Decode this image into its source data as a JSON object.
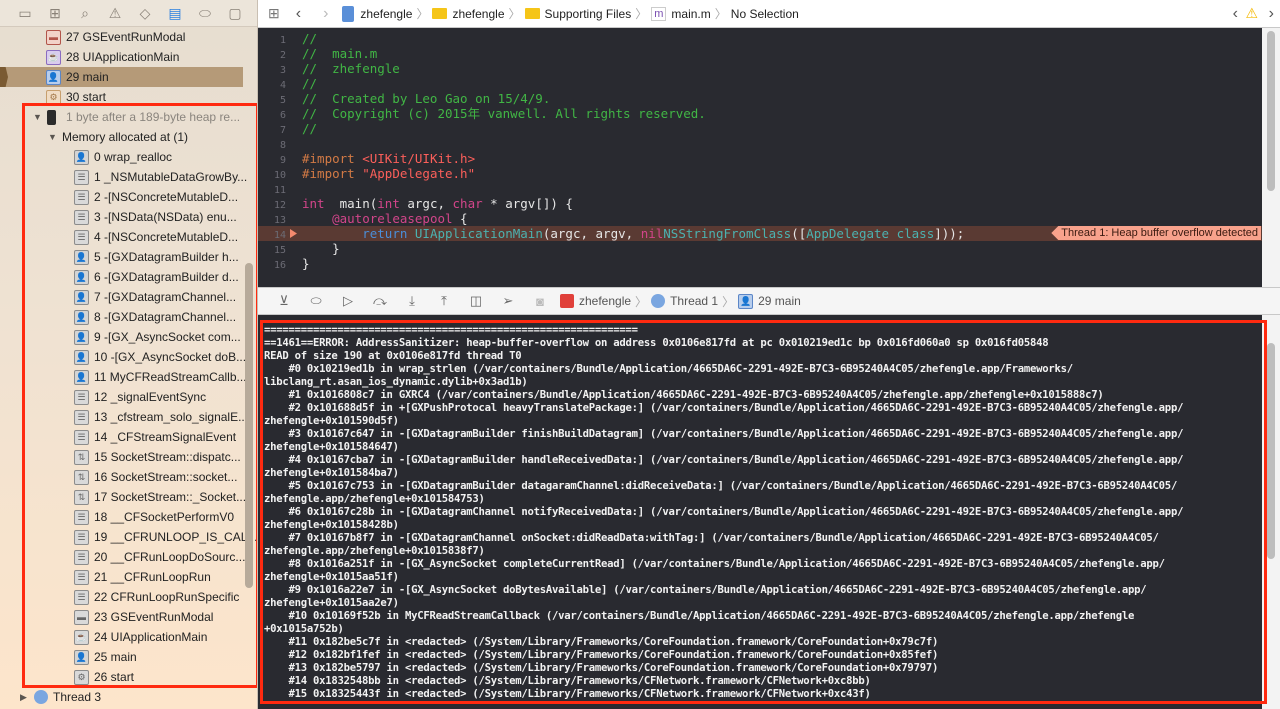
{
  "navigator": {
    "tabs": [
      "folder-icon",
      "hierarchy-icon",
      "search-icon",
      "warning-icon",
      "breakpoint-diamond-icon",
      "debug-navigator-icon",
      "breakpoint-tag-icon",
      "report-icon"
    ],
    "active_tab": "debug-navigator-icon",
    "frames": [
      {
        "label": "27 GSEventRunModal",
        "icon": "briefcase",
        "level": 0
      },
      {
        "label": "28 UIApplicationMain",
        "icon": "cup",
        "level": 0
      },
      {
        "label": "29 main",
        "icon": "user",
        "level": 0,
        "selected": true
      },
      {
        "label": "30 start",
        "icon": "gear",
        "level": 0
      }
    ],
    "asan_issue": {
      "title": "1 byte after a 189-byte heap re...",
      "group": "Memory allocated at (1)",
      "frames": [
        {
          "label": "0 wrap_realloc",
          "icon": "gray-user"
        },
        {
          "label": "1 _NSMutableDataGrowBy...",
          "icon": "lib"
        },
        {
          "label": "2 -[NSConcreteMutableD...",
          "icon": "lib"
        },
        {
          "label": "3 -[NSData(NSData) enu...",
          "icon": "lib"
        },
        {
          "label": "4 -[NSConcreteMutableD...",
          "icon": "lib"
        },
        {
          "label": "5 -[GXDatagramBuilder h...",
          "icon": "gray-user"
        },
        {
          "label": "6 -[GXDatagramBuilder d...",
          "icon": "gray-user"
        },
        {
          "label": "7 -[GXDatagramChannel...",
          "icon": "gray-user"
        },
        {
          "label": "8 -[GXDatagramChannel...",
          "icon": "gray-user"
        },
        {
          "label": "9 -[GX_AsyncSocket com...",
          "icon": "gray-user"
        },
        {
          "label": "10 -[GX_AsyncSocket doB...",
          "icon": "gray-user"
        },
        {
          "label": "11 MyCFReadStreamCallb...",
          "icon": "gray-user"
        },
        {
          "label": "12 _signalEventSync",
          "icon": "lib"
        },
        {
          "label": "13 _cfstream_solo_signalE...",
          "icon": "lib"
        },
        {
          "label": "14 _CFStreamSignalEvent",
          "icon": "lib"
        },
        {
          "label": "15 SocketStream::dispatc...",
          "icon": "socket"
        },
        {
          "label": "16 SocketStream::socket...",
          "icon": "socket"
        },
        {
          "label": "17 SocketStream::_Socket...",
          "icon": "socket"
        },
        {
          "label": "18 __CFSocketPerformV0",
          "icon": "lib"
        },
        {
          "label": "19 __CFRUNLOOP_IS_CAL...",
          "icon": "lib"
        },
        {
          "label": "20 __CFRunLoopDoSourc...",
          "icon": "lib"
        },
        {
          "label": "21 __CFRunLoopRun",
          "icon": "lib"
        },
        {
          "label": "22 CFRunLoopRunSpecific",
          "icon": "lib"
        },
        {
          "label": "23 GSEventRunModal",
          "icon": "briefcase-gray"
        },
        {
          "label": "24 UIApplicationMain",
          "icon": "cup-gray"
        },
        {
          "label": "25 main",
          "icon": "gray-user"
        },
        {
          "label": "26 start",
          "icon": "gear-gray"
        }
      ]
    },
    "thread3": "Thread 3"
  },
  "jumpbar": {
    "crumbs": [
      "zhefengle",
      "zhefengle",
      "Supporting Files",
      "main.m",
      "No Selection"
    ]
  },
  "editor": {
    "lines": [
      [
        [
          "cm",
          "//"
        ]
      ],
      [
        [
          "cm",
          "//  main.m"
        ]
      ],
      [
        [
          "cm",
          "//  zhefengle"
        ]
      ],
      [
        [
          "cm",
          "//"
        ]
      ],
      [
        [
          "cm",
          "//  Created by Leo Gao on 15/4/9."
        ]
      ],
      [
        [
          "cm",
          "//  Copyright (c) 2015年 vanwell. All rights reserved."
        ]
      ],
      [
        [
          "cm",
          "//"
        ]
      ],
      [],
      [
        [
          "pp",
          "#import "
        ],
        [
          "st",
          "<UIKit/UIKit.h>"
        ]
      ],
      [
        [
          "pp",
          "#import "
        ],
        [
          "st",
          "\"AppDelegate.h\""
        ]
      ],
      [],
      [
        [
          "kw",
          "int"
        ],
        [
          "",
          "  main("
        ],
        [
          "kw",
          "int"
        ],
        [
          "",
          " argc, "
        ],
        [
          "kw",
          "char"
        ],
        [
          "",
          " * argv[]) {"
        ]
      ],
      [
        [
          "",
          "    "
        ],
        [
          "kw",
          "@autoreleasepool"
        ],
        [
          "",
          " {"
        ]
      ],
      [
        [
          "",
          "        "
        ],
        [
          "kb",
          "return"
        ],
        [
          "",
          " "
        ],
        [
          "fn",
          "UIApplicationMain"
        ],
        [
          "",
          "(argc, argv, "
        ],
        [
          "kw",
          "nil"
        ],
        [
          ", ",
          ""
        ],
        [
          "fn",
          "NSStringFromClass"
        ],
        [
          "",
          "(["
        ],
        [
          "fn",
          "AppDelegate"
        ],
        [
          "",
          " "
        ],
        [
          "fn",
          "class"
        ],
        [
          "",
          "]));"
        ]
      ],
      [
        [
          "",
          "    }"
        ]
      ],
      [
        [
          "",
          "}"
        ]
      ]
    ],
    "highlighted_line": 14,
    "issue_badge": "Thread 1: Heap buffer overflow detected"
  },
  "debugbar": {
    "process": "zhefengle",
    "thread": "Thread 1",
    "frame": "29 main"
  },
  "console": {
    "lines": [
      "=============================================================",
      "==1461==ERROR: AddressSanitizer: heap-buffer-overflow on address 0x0106e817fd at pc 0x010219ed1c bp 0x016fd060a0 sp 0x016fd05848",
      "READ of size 190 at 0x0106e817fd thread T0",
      "    #0 0x10219ed1b in wrap_strlen (/var/containers/Bundle/Application/4665DA6C-2291-492E-B7C3-6B95240A4C05/zhefengle.app/Frameworks/",
      "libclang_rt.asan_ios_dynamic.dylib+0x3ad1b)",
      "    #1 0x1016808c7 in GXRC4 (/var/containers/Bundle/Application/4665DA6C-2291-492E-B7C3-6B95240A4C05/zhefengle.app/zhefengle+0x1015888c7)",
      "    #2 0x101688d5f in +[GXPushProtocal heavyTranslatePackage:] (/var/containers/Bundle/Application/4665DA6C-2291-492E-B7C3-6B95240A4C05/zhefengle.app/",
      "zhefengle+0x101590d5f)",
      "    #3 0x10167c647 in -[GXDatagramBuilder finishBuildDatagram] (/var/containers/Bundle/Application/4665DA6C-2291-492E-B7C3-6B95240A4C05/zhefengle.app/",
      "zhefengle+0x101584647)",
      "    #4 0x10167cba7 in -[GXDatagramBuilder handleReceivedData:] (/var/containers/Bundle/Application/4665DA6C-2291-492E-B7C3-6B95240A4C05/zhefengle.app/",
      "zhefengle+0x101584ba7)",
      "    #5 0x10167c753 in -[GXDatagramBuilder datagaramChannel:didReceiveData:] (/var/containers/Bundle/Application/4665DA6C-2291-492E-B7C3-6B95240A4C05/",
      "zhefengle.app/zhefengle+0x101584753)",
      "    #6 0x10167c28b in -[GXDatagramChannel notifyReceivedData:] (/var/containers/Bundle/Application/4665DA6C-2291-492E-B7C3-6B95240A4C05/zhefengle.app/",
      "zhefengle+0x10158428b)",
      "    #7 0x10167b8f7 in -[GXDatagramChannel onSocket:didReadData:withTag:] (/var/containers/Bundle/Application/4665DA6C-2291-492E-B7C3-6B95240A4C05/",
      "zhefengle.app/zhefengle+0x1015838f7)",
      "    #8 0x1016a251f in -[GX_AsyncSocket completeCurrentRead] (/var/containers/Bundle/Application/4665DA6C-2291-492E-B7C3-6B95240A4C05/zhefengle.app/",
      "zhefengle+0x1015aa51f)",
      "    #9 0x1016a22e7 in -[GX_AsyncSocket doBytesAvailable] (/var/containers/Bundle/Application/4665DA6C-2291-492E-B7C3-6B95240A4C05/zhefengle.app/",
      "zhefengle+0x1015aa2e7)",
      "    #10 0x10169f52b in MyCFReadStreamCallback (/var/containers/Bundle/Application/4665DA6C-2291-492E-B7C3-6B95240A4C05/zhefengle.app/zhefengle",
      "+0x1015a752b)",
      "    #11 0x182be5c7f in <redacted> (/System/Library/Frameworks/CoreFoundation.framework/CoreFoundation+0x79c7f)",
      "    #12 0x182bf1fef in <redacted> (/System/Library/Frameworks/CoreFoundation.framework/CoreFoundation+0x85fef)",
      "    #13 0x182be5797 in <redacted> (/System/Library/Frameworks/CoreFoundation.framework/CoreFoundation+0x79797)",
      "    #14 0x1832548bb in <redacted> (/System/Library/Frameworks/CFNetwork.framework/CFNetwork+0xc8bb)",
      "    #15 0x18325443f in <redacted> (/System/Library/Frameworks/CFNetwork.framework/CFNetwork+0xc43f)"
    ]
  }
}
